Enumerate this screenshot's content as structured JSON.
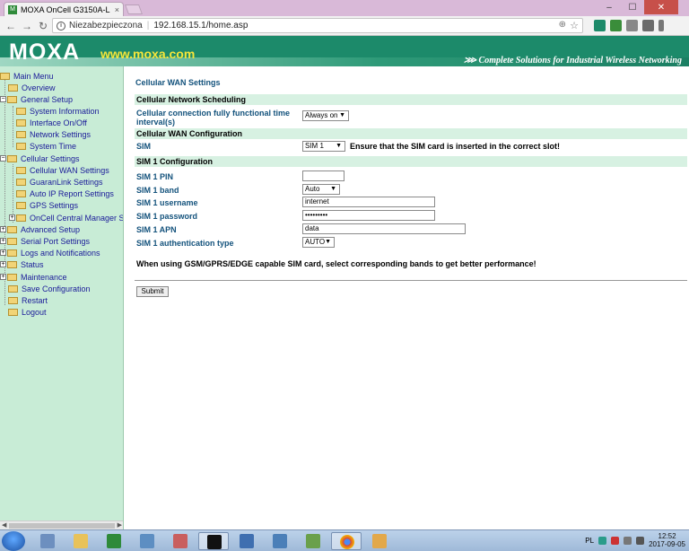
{
  "browser": {
    "tab_title": "MOXA OnCell G3150A-L",
    "tab_close": "×",
    "secure_label": "Niezabezpieczona",
    "url": "192.168.15.1/home.asp",
    "win_minimize": "–",
    "win_maximize": "☐",
    "win_close": "✕"
  },
  "banner": {
    "logo": "MOXA",
    "site": "www.moxa.com",
    "tagline": "⋙ Complete Solutions for Industrial Wireless Networking"
  },
  "sidebar": {
    "items": [
      {
        "label": "Main Menu"
      },
      {
        "label": "Overview"
      },
      {
        "label": "General Setup"
      },
      {
        "label": "System Information"
      },
      {
        "label": "Interface On/Off"
      },
      {
        "label": "Network Settings"
      },
      {
        "label": "System Time"
      },
      {
        "label": "Cellular Settings"
      },
      {
        "label": "Cellular WAN Settings"
      },
      {
        "label": "GuaranLink Settings"
      },
      {
        "label": "Auto IP Report Settings"
      },
      {
        "label": "GPS Settings"
      },
      {
        "label": "OnCell Central Manager Settings"
      },
      {
        "label": "Advanced Setup"
      },
      {
        "label": "Serial Port Settings"
      },
      {
        "label": "Logs and Notifications"
      },
      {
        "label": "Status"
      },
      {
        "label": "Maintenance"
      },
      {
        "label": "Save Configuration"
      },
      {
        "label": "Restart"
      },
      {
        "label": "Logout"
      }
    ]
  },
  "main": {
    "title": "Cellular WAN Settings",
    "sections": {
      "scheduling": "Cellular Network Scheduling",
      "wan_config": "Cellular WAN Configuration",
      "sim1_config": "SIM 1 Configuration"
    },
    "fields": {
      "fully_functional_label": "Cellular connection fully functional time interval(s)",
      "fully_functional_value": "Always on",
      "sim_label": "SIM",
      "sim_value": "SIM 1",
      "sim_note": "Ensure that the SIM card is inserted in the correct slot!",
      "pin_label": "SIM 1 PIN",
      "pin_value": "",
      "band_label": "SIM 1 band",
      "band_value": "Auto",
      "username_label": "SIM 1 username",
      "username_value": "internet",
      "password_label": "SIM 1 password",
      "password_value": "•••••••••",
      "apn_label": "SIM 1 APN",
      "apn_value": "data",
      "auth_label": "SIM 1 authentication type",
      "auth_value": "AUTO"
    },
    "band_note": "When using GSM/GPRS/EDGE capable SIM card, select corresponding bands to get better performance!",
    "submit_label": "Submit"
  },
  "taskbar": {
    "lang": "PL",
    "time": "12:52",
    "date": "2017-09-05"
  },
  "colors": {
    "banner_green": "#1c8a6a",
    "sidebar_bg": "#c8ecd6",
    "section_bg": "#d7f1e2",
    "label_blue": "#13527c"
  }
}
